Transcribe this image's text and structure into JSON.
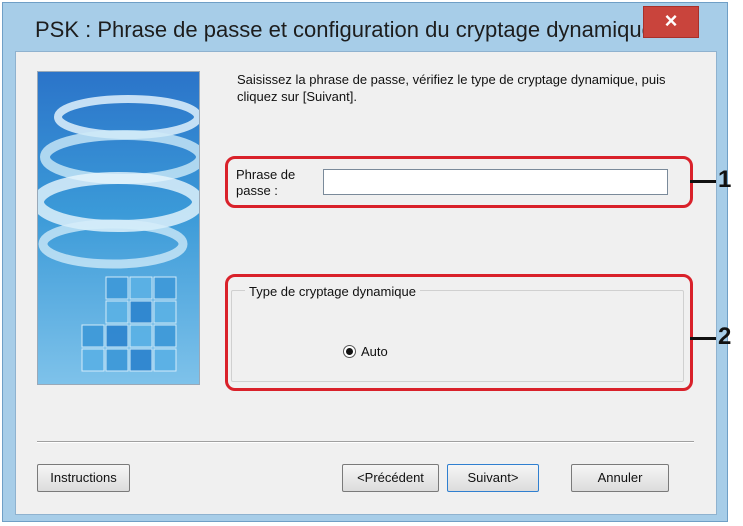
{
  "window": {
    "title": "PSK : Phrase de passe et configuration du cryptage dynamique",
    "close_label": "×"
  },
  "instruction": "Saisissez la phrase de passe, vérifiez le type de cryptage dynamique, puis cliquez sur [Suivant].",
  "passphrase": {
    "label": "Phrase de passe :",
    "value": ""
  },
  "encryption": {
    "group_label": "Type de cryptage dynamique",
    "option_label": "Auto",
    "selected": "Auto"
  },
  "callouts": [
    "1",
    "2"
  ],
  "buttons": {
    "instructions": "Instructions",
    "previous": "<Précédent",
    "next": "Suivant>",
    "cancel": "Annuler"
  },
  "colors": {
    "callout": "#d9212a",
    "title_bar": "#a7cde8",
    "close": "#c9443c"
  }
}
